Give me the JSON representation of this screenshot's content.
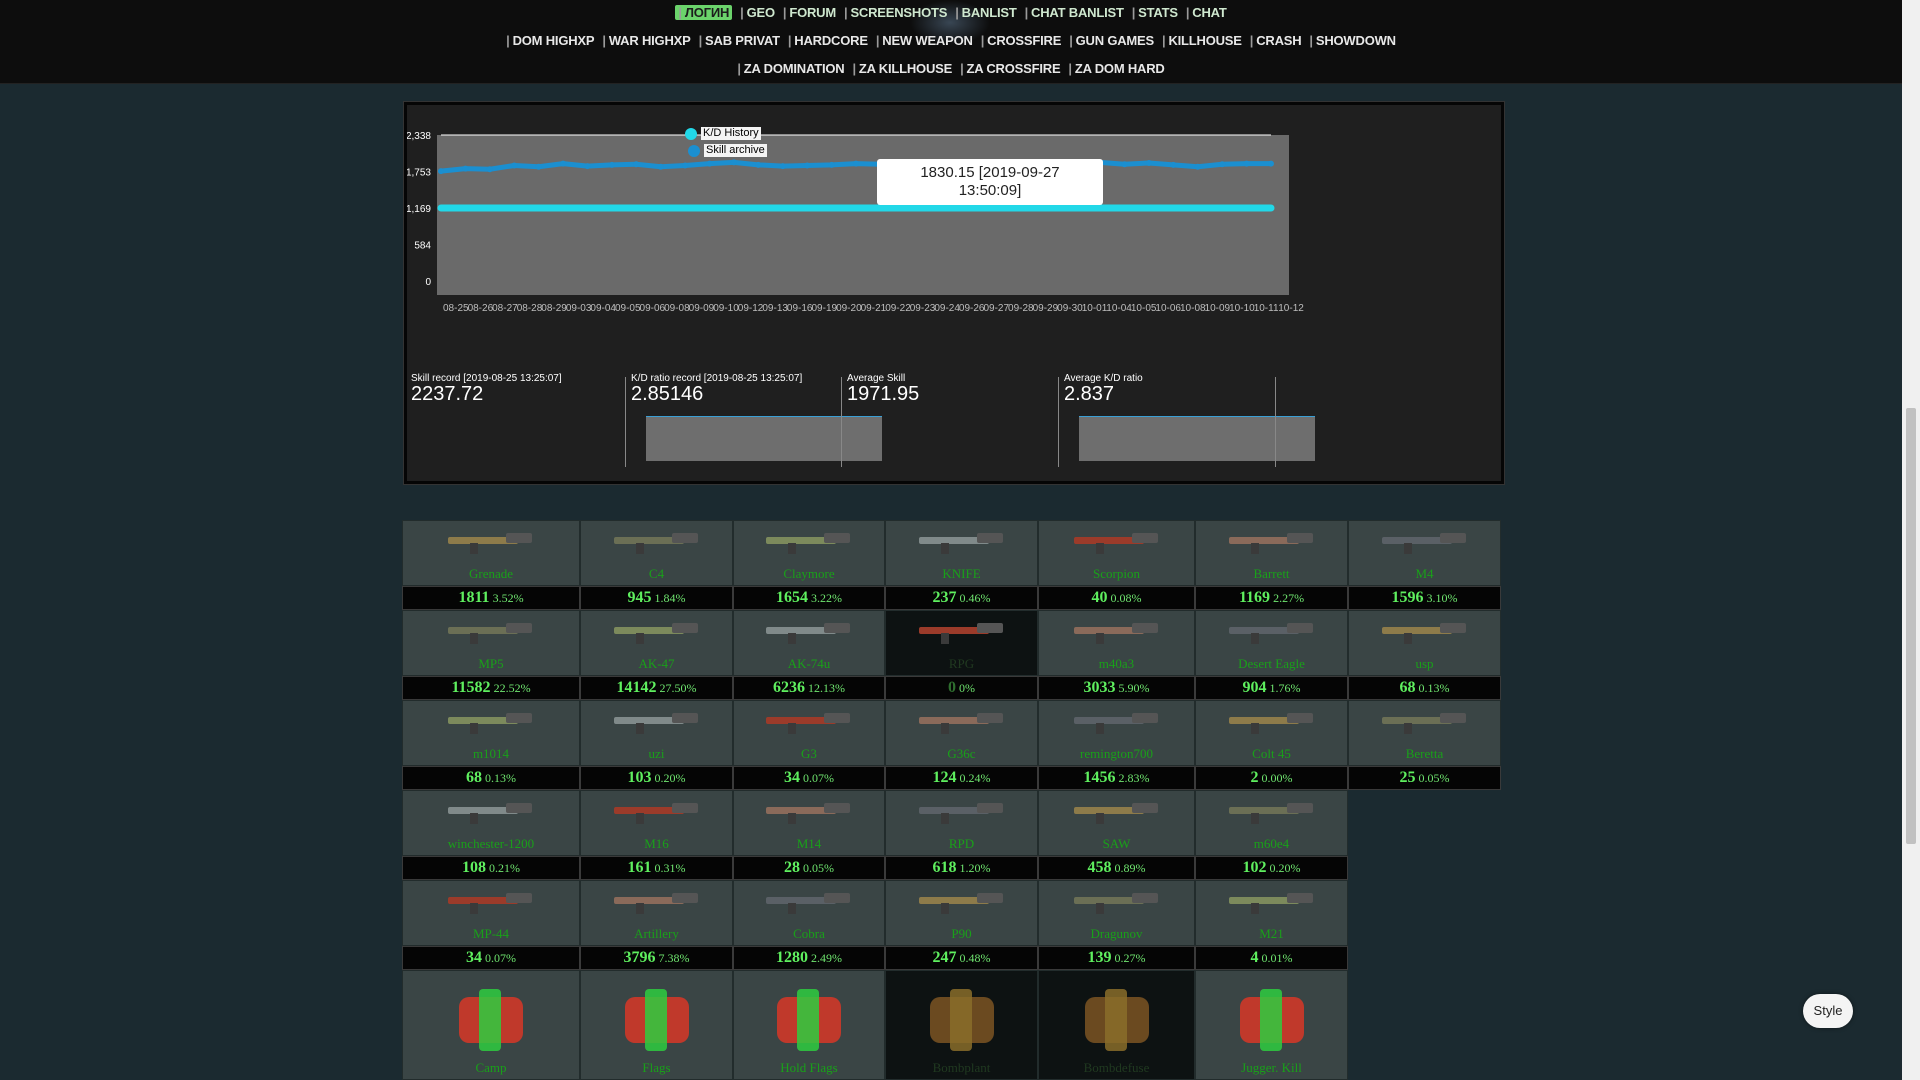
{
  "nav": {
    "row1": [
      "ЛОГИН",
      "GEO",
      "FORUM",
      "SCREENSHOTS",
      "BANLIST",
      "CHAT BANLIST",
      "STATS",
      "CHAT"
    ],
    "row2": [
      "DOM HIGHXP",
      "WAR HIGHXP",
      "SAB PRIVAT",
      "HARDCORE",
      "NEW WEAPON",
      "CROSSFIRE",
      "GUN GAMES",
      "KILLHOUSE",
      "CRASH",
      "SHOWDOWN"
    ],
    "row3": [
      "ZA DOMINATION",
      "ZA KILLHOUSE",
      "ZA CROSSFIRE",
      "ZA DOM HARD"
    ],
    "active": "ЛОГИН"
  },
  "chart": {
    "legend": [
      {
        "label": "K/D History",
        "color": "#22d8e8"
      },
      {
        "label": "Skill archive",
        "color": "#1b8fd0"
      }
    ],
    "tooltip": {
      "line1": "1830.15 [2019-09-27",
      "line2": "13:50:09]"
    },
    "y_ticks": [
      "2,338",
      "1,753",
      "1,169",
      "584",
      "0"
    ],
    "x_ticks": [
      "08-25",
      "08-26",
      "08-27",
      "08-28",
      "08-29",
      "09-03",
      "09-04",
      "09-05",
      "09-06",
      "09-08",
      "09-09",
      "09-10",
      "09-12",
      "09-13",
      "09-16",
      "09-19",
      "09-20",
      "09-21",
      "09-22",
      "09-23",
      "09-24",
      "09-26",
      "09-27",
      "09-28",
      "09-29",
      "09-30",
      "10-01",
      "10-04",
      "10-05",
      "10-06",
      "10-08",
      "10-09",
      "10-10",
      "10-11",
      "10-12"
    ]
  },
  "chart_data": {
    "type": "line",
    "x": [
      "08-25",
      "08-26",
      "08-27",
      "08-28",
      "08-29",
      "09-03",
      "09-04",
      "09-05",
      "09-06",
      "09-08",
      "09-09",
      "09-10",
      "09-12",
      "09-13",
      "09-16",
      "09-19",
      "09-20",
      "09-21",
      "09-22",
      "09-23",
      "09-24",
      "09-26",
      "09-27",
      "09-28",
      "09-29",
      "09-30",
      "10-01",
      "10-04",
      "10-05",
      "10-06",
      "10-08",
      "10-09",
      "10-10",
      "10-11",
      "10-12"
    ],
    "ylim": [
      0,
      2338
    ],
    "grid": false,
    "legend": "top-left",
    "series": [
      {
        "name": "Skill archive",
        "color": "#1b8fd0",
        "values": [
          1760,
          1800,
          1790,
          1850,
          1830,
          1880,
          1840,
          1860,
          1870,
          1830,
          1850,
          1880,
          1900,
          1860,
          1840,
          1850,
          1860,
          1880,
          1870,
          1880,
          1850,
          1870,
          1830,
          1860,
          1840,
          1870,
          1880,
          1900,
          1870,
          1890,
          1860,
          1830,
          1870,
          1880,
          1880
        ]
      },
      {
        "name": "K/D History",
        "color": "#22d8e8",
        "values": [
          1169,
          1169,
          1169,
          1169,
          1169,
          1169,
          1169,
          1169,
          1169,
          1169,
          1169,
          1169,
          1169,
          1169,
          1169,
          1169,
          1169,
          1169,
          1169,
          1169,
          1169,
          1169,
          1169,
          1169,
          1169,
          1169,
          1169,
          1169,
          1169,
          1169,
          1169,
          1169,
          1169,
          1169,
          1169
        ]
      }
    ]
  },
  "stats": [
    {
      "label": "Skill record [2019-08-25 13:25:07]",
      "value": "2237.72"
    },
    {
      "label": "K/D ratio record [2019-08-25 13:25:07]",
      "value": "2.85146"
    },
    {
      "label": "Average Skill",
      "value": "1971.95"
    },
    {
      "label": "Average K/D ratio",
      "value": "2.837"
    }
  ],
  "weapons": [
    [
      {
        "name": "Grenade",
        "count": "1811",
        "pct": "3.52%",
        "icon": "grenade-icon"
      },
      {
        "name": "C4",
        "count": "945",
        "pct": "1.84%",
        "icon": "c4-icon"
      },
      {
        "name": "Claymore",
        "count": "1654",
        "pct": "3.22%",
        "icon": "claymore-icon"
      },
      {
        "name": "KNIFE",
        "count": "237",
        "pct": "0.46%",
        "icon": "knife-icon"
      },
      {
        "name": "Scorpion",
        "count": "40",
        "pct": "0.08%",
        "icon": "scorpion-icon"
      },
      {
        "name": "Barrett",
        "count": "1169",
        "pct": "2.27%",
        "icon": "barrett-icon"
      },
      {
        "name": "M4",
        "count": "1596",
        "pct": "3.10%",
        "icon": "m4-icon"
      }
    ],
    [
      {
        "name": "MP5",
        "count": "11582",
        "pct": "22.52%",
        "icon": "mp5-icon"
      },
      {
        "name": "AK-47",
        "count": "14142",
        "pct": "27.50%",
        "icon": "ak47-icon"
      },
      {
        "name": "AK-74u",
        "count": "6236",
        "pct": "12.13%",
        "icon": "ak74u-icon"
      },
      {
        "name": "RPG",
        "count": "0",
        "pct": "0%",
        "icon": "rpg-icon",
        "dark": true
      },
      {
        "name": "m40a3",
        "count": "3033",
        "pct": "5.90%",
        "icon": "m40a3-icon"
      },
      {
        "name": "Desert Eagle",
        "count": "904",
        "pct": "1.76%",
        "icon": "desert-eagle-icon"
      },
      {
        "name": "usp",
        "count": "68",
        "pct": "0.13%",
        "icon": "usp-icon"
      }
    ],
    [
      {
        "name": "m1014",
        "count": "68",
        "pct": "0.13%",
        "icon": "m1014-icon"
      },
      {
        "name": "uzi",
        "count": "103",
        "pct": "0.20%",
        "icon": "uzi-icon"
      },
      {
        "name": "G3",
        "count": "34",
        "pct": "0.07%",
        "icon": "g3-icon"
      },
      {
        "name": "G36c",
        "count": "124",
        "pct": "0.24%",
        "icon": "g36c-icon"
      },
      {
        "name": "remington700",
        "count": "1456",
        "pct": "2.83%",
        "icon": "remington-icon"
      },
      {
        "name": "Colt 45",
        "count": "2",
        "pct": "0.00%",
        "icon": "colt45-icon"
      },
      {
        "name": "Beretta",
        "count": "25",
        "pct": "0.05%",
        "icon": "beretta-icon"
      }
    ],
    [
      {
        "name": "winchester-1200",
        "count": "108",
        "pct": "0.21%",
        "icon": "winchester-icon"
      },
      {
        "name": "M16",
        "count": "161",
        "pct": "0.31%",
        "icon": "m16-icon"
      },
      {
        "name": "M14",
        "count": "28",
        "pct": "0.05%",
        "icon": "m14-icon"
      },
      {
        "name": "RPD",
        "count": "618",
        "pct": "1.20%",
        "icon": "rpd-icon"
      },
      {
        "name": "SAW",
        "count": "458",
        "pct": "0.89%",
        "icon": "saw-icon"
      },
      {
        "name": "m60e4",
        "count": "102",
        "pct": "0.20%",
        "icon": "m60e4-icon"
      }
    ],
    [
      {
        "name": "MP-44",
        "count": "34",
        "pct": "0.07%",
        "icon": "mp44-icon"
      },
      {
        "name": "Artillery",
        "count": "3796",
        "pct": "7.38%",
        "icon": "artillery-icon"
      },
      {
        "name": "Cobra",
        "count": "1280",
        "pct": "2.49%",
        "icon": "cobra-icon"
      },
      {
        "name": "P90",
        "count": "247",
        "pct": "0.48%",
        "icon": "p90-icon"
      },
      {
        "name": "Dragunov",
        "count": "139",
        "pct": "0.27%",
        "icon": "dragunov-icon"
      },
      {
        "name": "M21",
        "count": "4",
        "pct": "0.01%",
        "icon": "m21-icon"
      }
    ],
    [
      {
        "name": "Camp",
        "icon": "camp-icon"
      },
      {
        "name": "Flags",
        "icon": "flags-icon"
      },
      {
        "name": "Hold Flags",
        "icon": "hold-flags-icon"
      },
      {
        "name": "Bombplant",
        "icon": "bombplant-icon",
        "dark": true
      },
      {
        "name": "Bombdefuse",
        "icon": "bombdefuse-icon",
        "dark": true
      },
      {
        "name": "Jugger. Kill",
        "icon": "jugger-icon"
      }
    ]
  ],
  "style_button": "Style"
}
